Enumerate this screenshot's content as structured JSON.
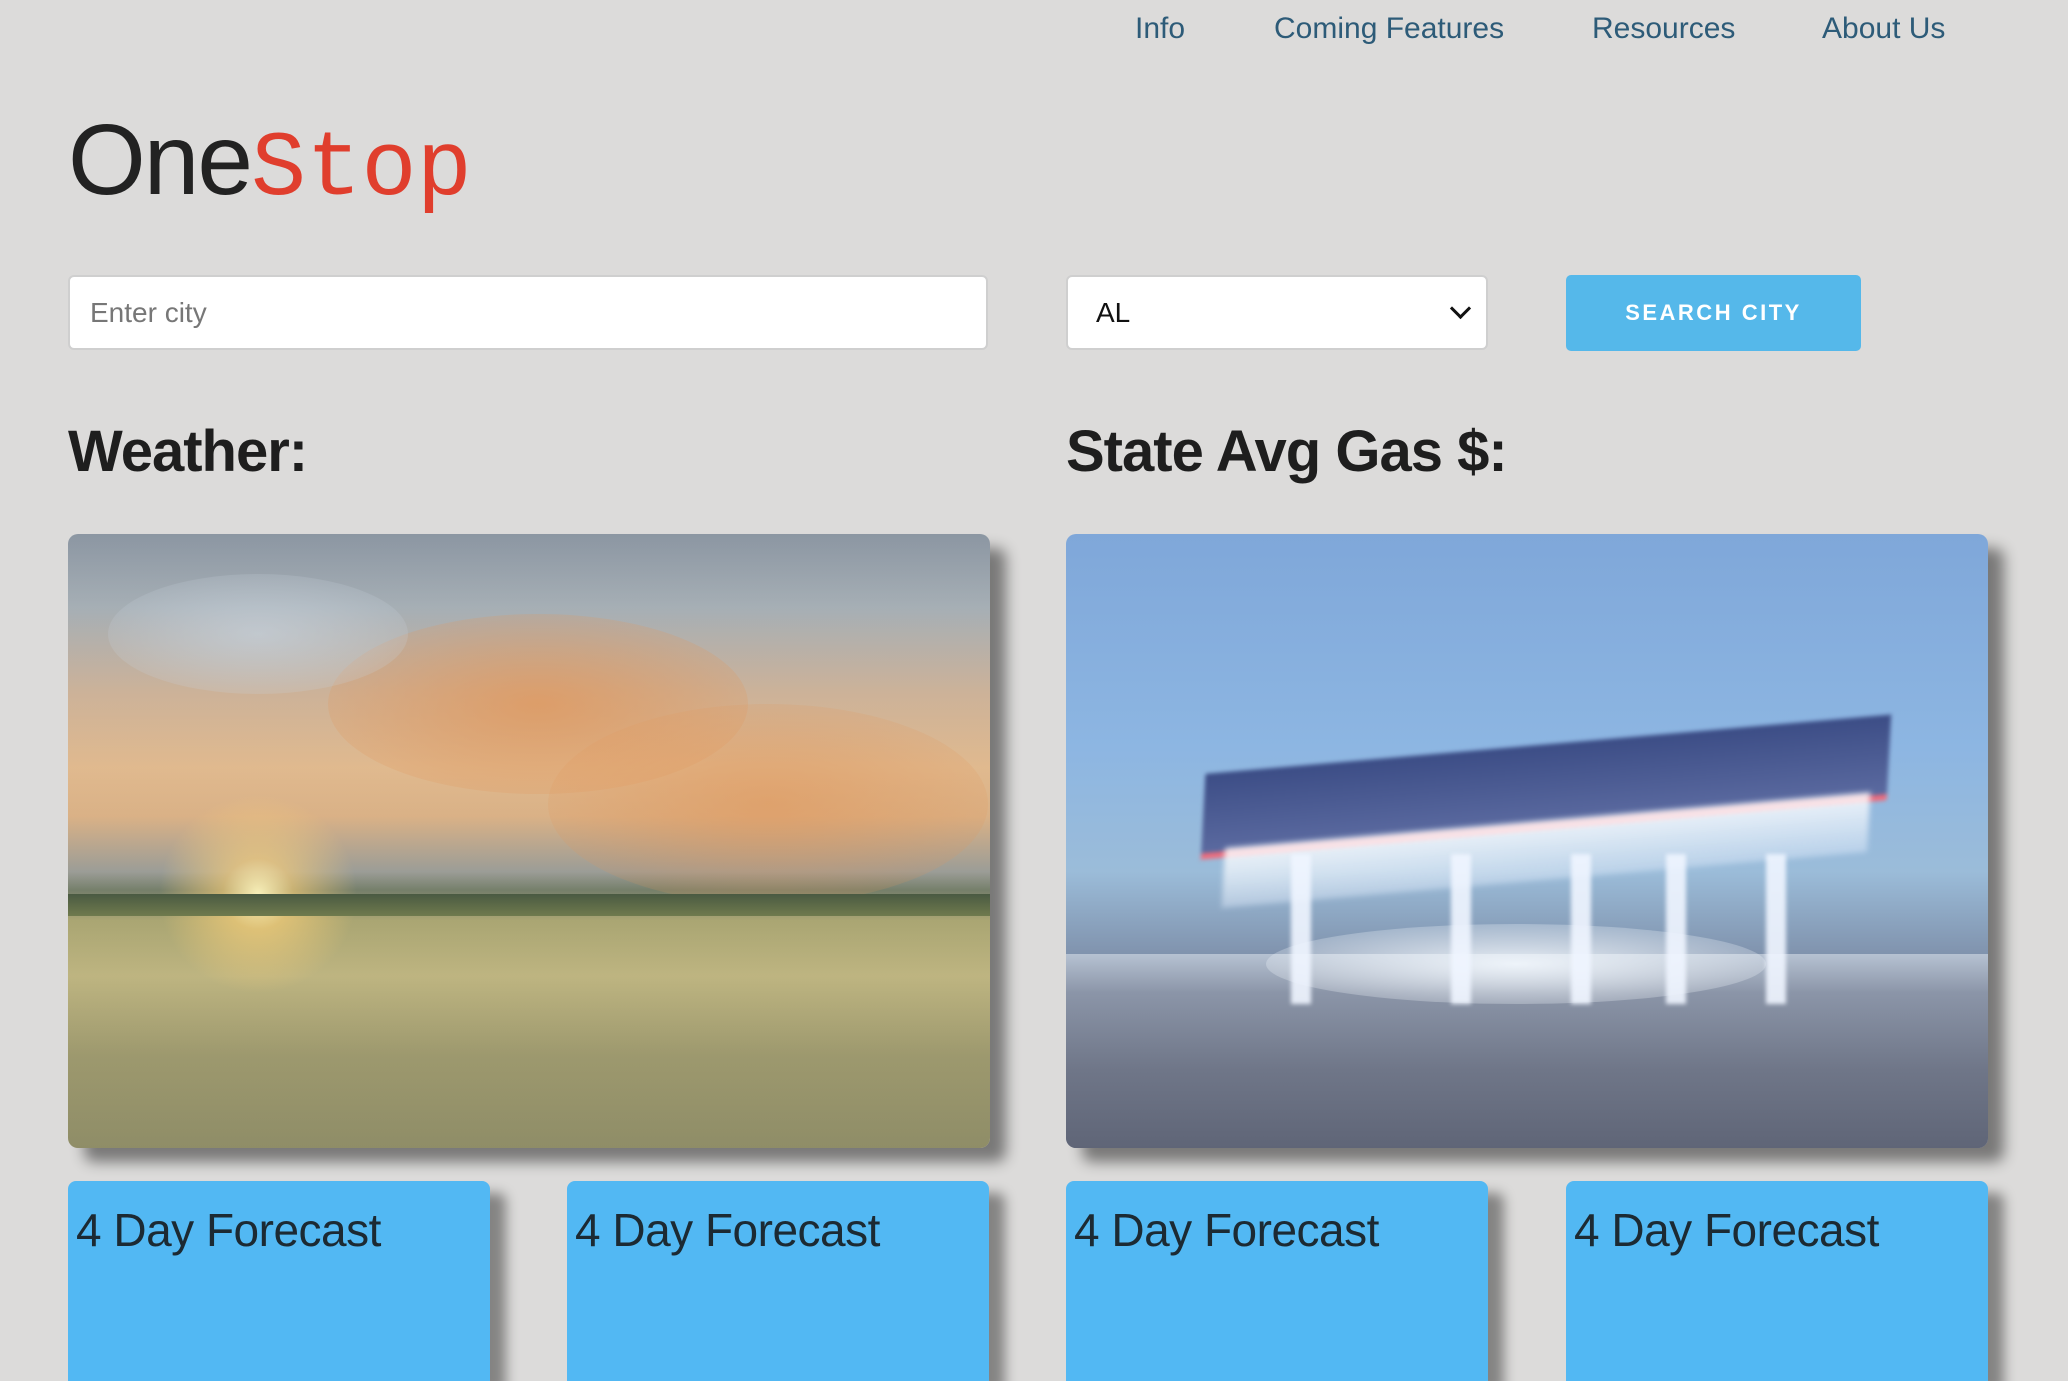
{
  "nav": {
    "items": [
      {
        "label": "Info"
      },
      {
        "label": "Coming Features"
      },
      {
        "label": "Resources"
      },
      {
        "label": "About Us"
      }
    ]
  },
  "brand": {
    "part1": "One",
    "part2": "Stop",
    "colors": {
      "part1": "#222222",
      "part2": "#e03e2d"
    }
  },
  "search": {
    "city_placeholder": "Enter city",
    "city_value": "",
    "state_selected": "AL",
    "button_label": "Search City",
    "accent_color": "#55b8ea"
  },
  "sections": {
    "weather_title": "Weather:",
    "gas_title": "State Avg Gas $:"
  },
  "forecast_cards": [
    {
      "label": "4 Day Forecast"
    },
    {
      "label": "4 Day Forecast"
    },
    {
      "label": "4 Day Forecast"
    },
    {
      "label": "4 Day Forecast"
    }
  ],
  "colors": {
    "background": "#dcdbda",
    "nav_link": "#2d5b78",
    "card": "#52b8f3"
  }
}
